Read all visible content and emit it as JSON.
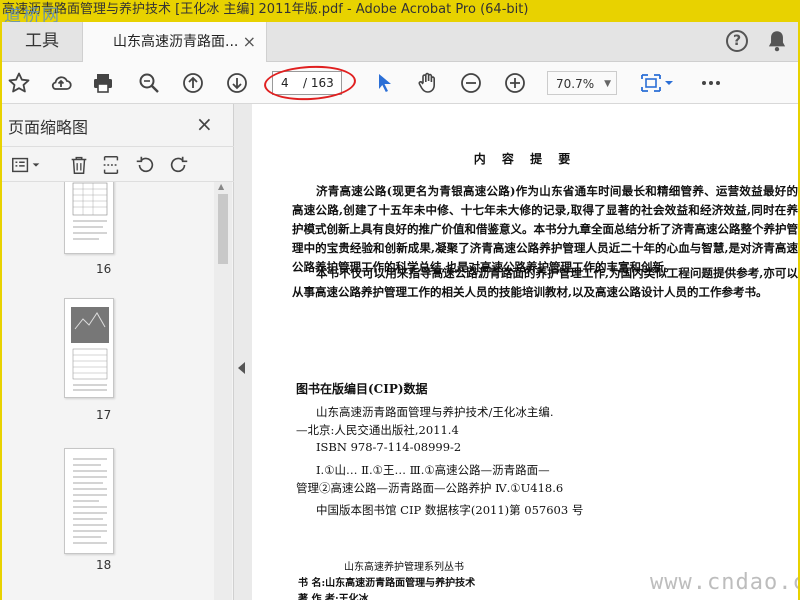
{
  "window": {
    "title": "高速沥青路面管理与养护技术 [王化冰 主编] 2011年版.pdf - Adobe Acrobat Pro (64-bit)",
    "watermark_logo": "道桥网"
  },
  "tabs": {
    "tools_label": "工具",
    "doc_label": "山东高速沥青路面...",
    "close_glyph": "×"
  },
  "toolbar": {
    "current_page": "4",
    "total_pages": "/ 163",
    "zoom": "70.7%"
  },
  "sidebar": {
    "title": "页面缩略图",
    "close_glyph": "×",
    "thumbnails": [
      {
        "label": "16"
      },
      {
        "label": "17"
      },
      {
        "label": "18"
      }
    ]
  },
  "document": {
    "heading": "内 容 提 要",
    "para1": "济青高速公路(现更名为青银高速公路)作为山东省通车时间最长和精细管养、运营效益最好的高速公路,创建了十五年未中修、十七年未大修的记录,取得了显著的社会效益和经济效益,同时在养护模式创新上具有良好的推广价值和借鉴意义。本书分九章全面总结分析了济青高速公路整个养护管理中的宝贵经验和创新成果,凝聚了济青高速公路养护管理人员近二十年的心血与智慧,是对济青高速公路养护管理工作的科学总结,也是对高速公路养护管理工作的丰富和创新。",
    "para2": "本书不仅可以用来指导高速公路沥青路面的养护管理工作,为国内类似工程问题提供参考,亦可以从事高速公路养护管理工作的相关人员的技能培训教材,以及高速公路设计人员的工作参考书。",
    "cip_title": "图书在版编目(CIP)数据",
    "cip_line1": "山东高速沥青路面管理与养护技术/王化冰主编.",
    "cip_line2": "—北京:人民交通出版社,2011.4",
    "cip_line3": "ISBN 978-7-114-08999-2",
    "cip_line4": "Ⅰ.①山…   Ⅱ.①王…   Ⅲ.①高速公路—沥青路面—",
    "cip_line5": "管理②高速公路—沥青路面—公路养护   Ⅳ.①U418.6",
    "cip_line6": "中国版本图书馆 CIP 数据核字(2011)第 057603 号",
    "series": "山东高速养护管理系列丛书",
    "book_line": "书    名:山东高速沥青路面管理与养护技术",
    "author_line": "著 作 者:王化冰",
    "site_watermark": "www.cndao.com"
  },
  "colors": {
    "titlebar": "#e8d200",
    "accent": "#2b6fd6",
    "annotation_ring": "#e02020"
  }
}
